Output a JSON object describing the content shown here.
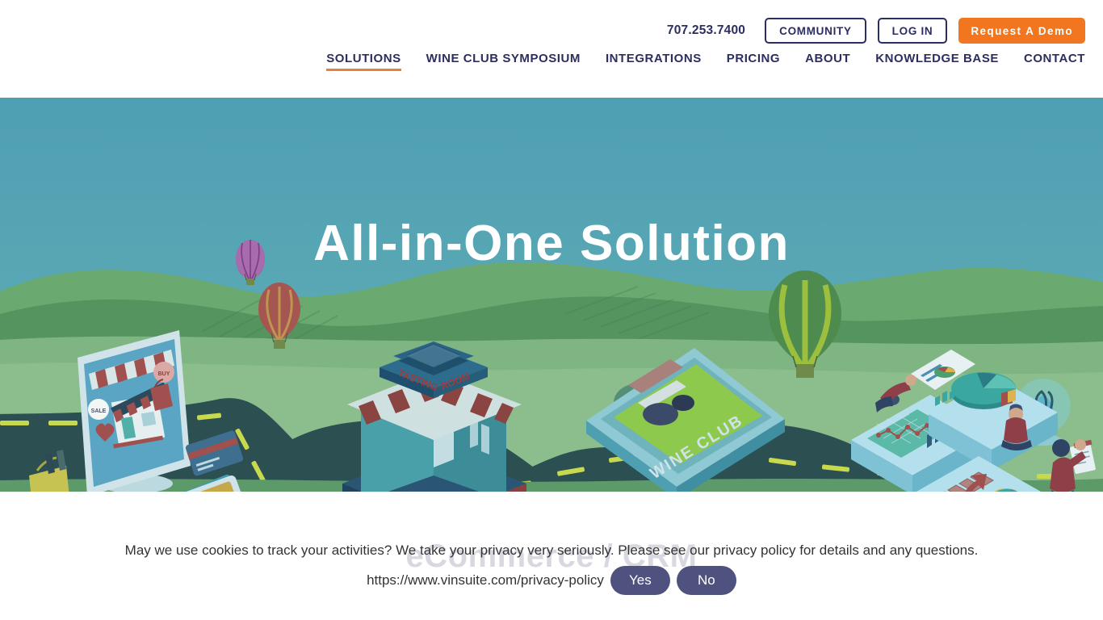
{
  "header": {
    "phone": "707.253.7400",
    "community_label": "COMMUNITY",
    "login_label": "LOG IN",
    "demo_label": "Request A Demo",
    "nav": [
      {
        "label": "SOLUTIONS",
        "active": true
      },
      {
        "label": "WINE CLUB SYMPOSIUM",
        "active": false
      },
      {
        "label": "INTEGRATIONS",
        "active": false
      },
      {
        "label": "PRICING",
        "active": false
      },
      {
        "label": "ABOUT",
        "active": false
      },
      {
        "label": "KNOWLEDGE BASE",
        "active": false
      },
      {
        "label": "CONTACT",
        "active": false
      }
    ]
  },
  "hero": {
    "title": "All-in-One Solution",
    "subtitle": "eCommerce / CRM",
    "illustration": {
      "labels": {
        "tasting_room": "TASTING ROOM",
        "wine_club": "WINE CLUB",
        "sale_badge": "SALE",
        "buy_badge": "BUY"
      },
      "elements": [
        "ecommerce-monitor",
        "credit-cards",
        "keyboard",
        "mobile-phone",
        "wine-bag",
        "price-tag",
        "tasting-room-building",
        "wine-club-box",
        "hot-air-balloon-purple",
        "hot-air-balloon-red",
        "hot-air-balloon-green",
        "analytics-puzzle-pieces",
        "lightbulb-plant",
        "winding-road"
      ]
    }
  },
  "cookie": {
    "message": "May we use cookies to track your activities? We take your privacy very seriously. Please see our privacy policy for details and any questions.",
    "url": "https://www.vinsuite.com/privacy-policy",
    "yes_label": "Yes",
    "no_label": "No"
  },
  "colors": {
    "brand_navy": "#2b2e5e",
    "brand_orange": "#f1761f",
    "nav_underline": "#e8823a",
    "sky": "#52a3b5",
    "grass": "#5c9a6a",
    "road": "#2c4f52",
    "road_dash": "#c8d94e",
    "cookie_button": "#4f517e"
  }
}
